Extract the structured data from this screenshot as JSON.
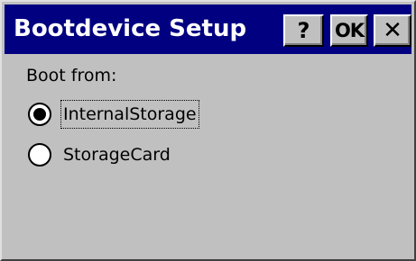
{
  "window": {
    "title": "Bootdevice Setup",
    "buttons": {
      "help_label": "?",
      "ok_label": "OK",
      "close_label": "✕"
    }
  },
  "boot": {
    "label": "Boot from:",
    "options": [
      {
        "label": "InternalStorage",
        "selected": true,
        "focused": true
      },
      {
        "label": "StorageCard",
        "selected": false,
        "focused": false
      }
    ]
  },
  "colors": {
    "titlebar": "#000080",
    "face": "#c0c0c0"
  }
}
